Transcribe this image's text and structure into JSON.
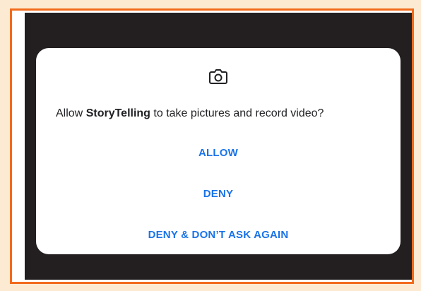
{
  "dialog": {
    "icon": "camera-icon",
    "message_prefix": "Allow ",
    "app_name": "StoryTelling",
    "message_suffix": " to take pictures and record video?",
    "buttons": {
      "allow": "ALLOW",
      "deny": "DENY",
      "deny_dont_ask": "DENY & DON’T ASK AGAIN"
    }
  },
  "colors": {
    "accent": "#1a73e8",
    "frame_border": "#f26a1b",
    "page_background": "#fcebd2",
    "screen_background": "#231f20"
  }
}
